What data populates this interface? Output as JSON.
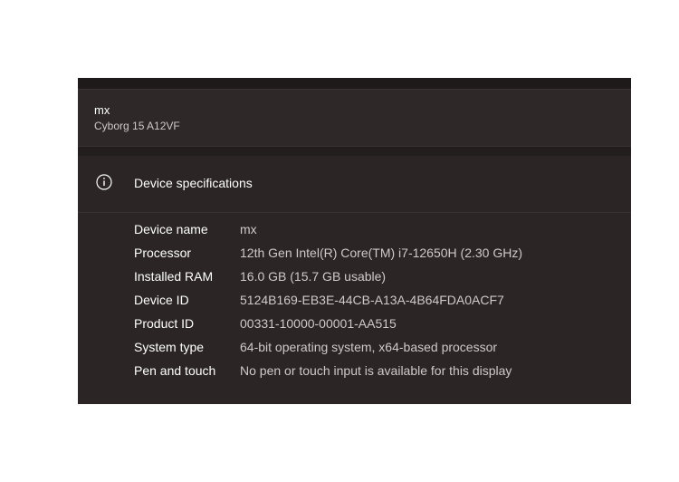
{
  "device": {
    "name": "mx",
    "model": "Cyborg 15 A12VF"
  },
  "specs": {
    "icon": "info-icon",
    "title": "Device specifications",
    "rows": [
      {
        "label": "Device name",
        "value": "mx"
      },
      {
        "label": "Processor",
        "value": "12th Gen Intel(R) Core(TM) i7-12650H (2.30 GHz)"
      },
      {
        "label": "Installed RAM",
        "value": "16.0 GB (15.7 GB usable)"
      },
      {
        "label": "Device ID",
        "value": "5124B169-EB3E-44CB-A13A-4B64FDA0ACF7"
      },
      {
        "label": "Product ID",
        "value": "00331-10000-00001-AA515"
      },
      {
        "label": "System type",
        "value": "64-bit operating system, x64-based processor"
      },
      {
        "label": "Pen and touch",
        "value": "No pen or touch input is available for this display"
      }
    ]
  },
  "colors": {
    "background": "#272222",
    "text_primary": "#ffffff",
    "text_secondary": "#cfc9c9"
  }
}
